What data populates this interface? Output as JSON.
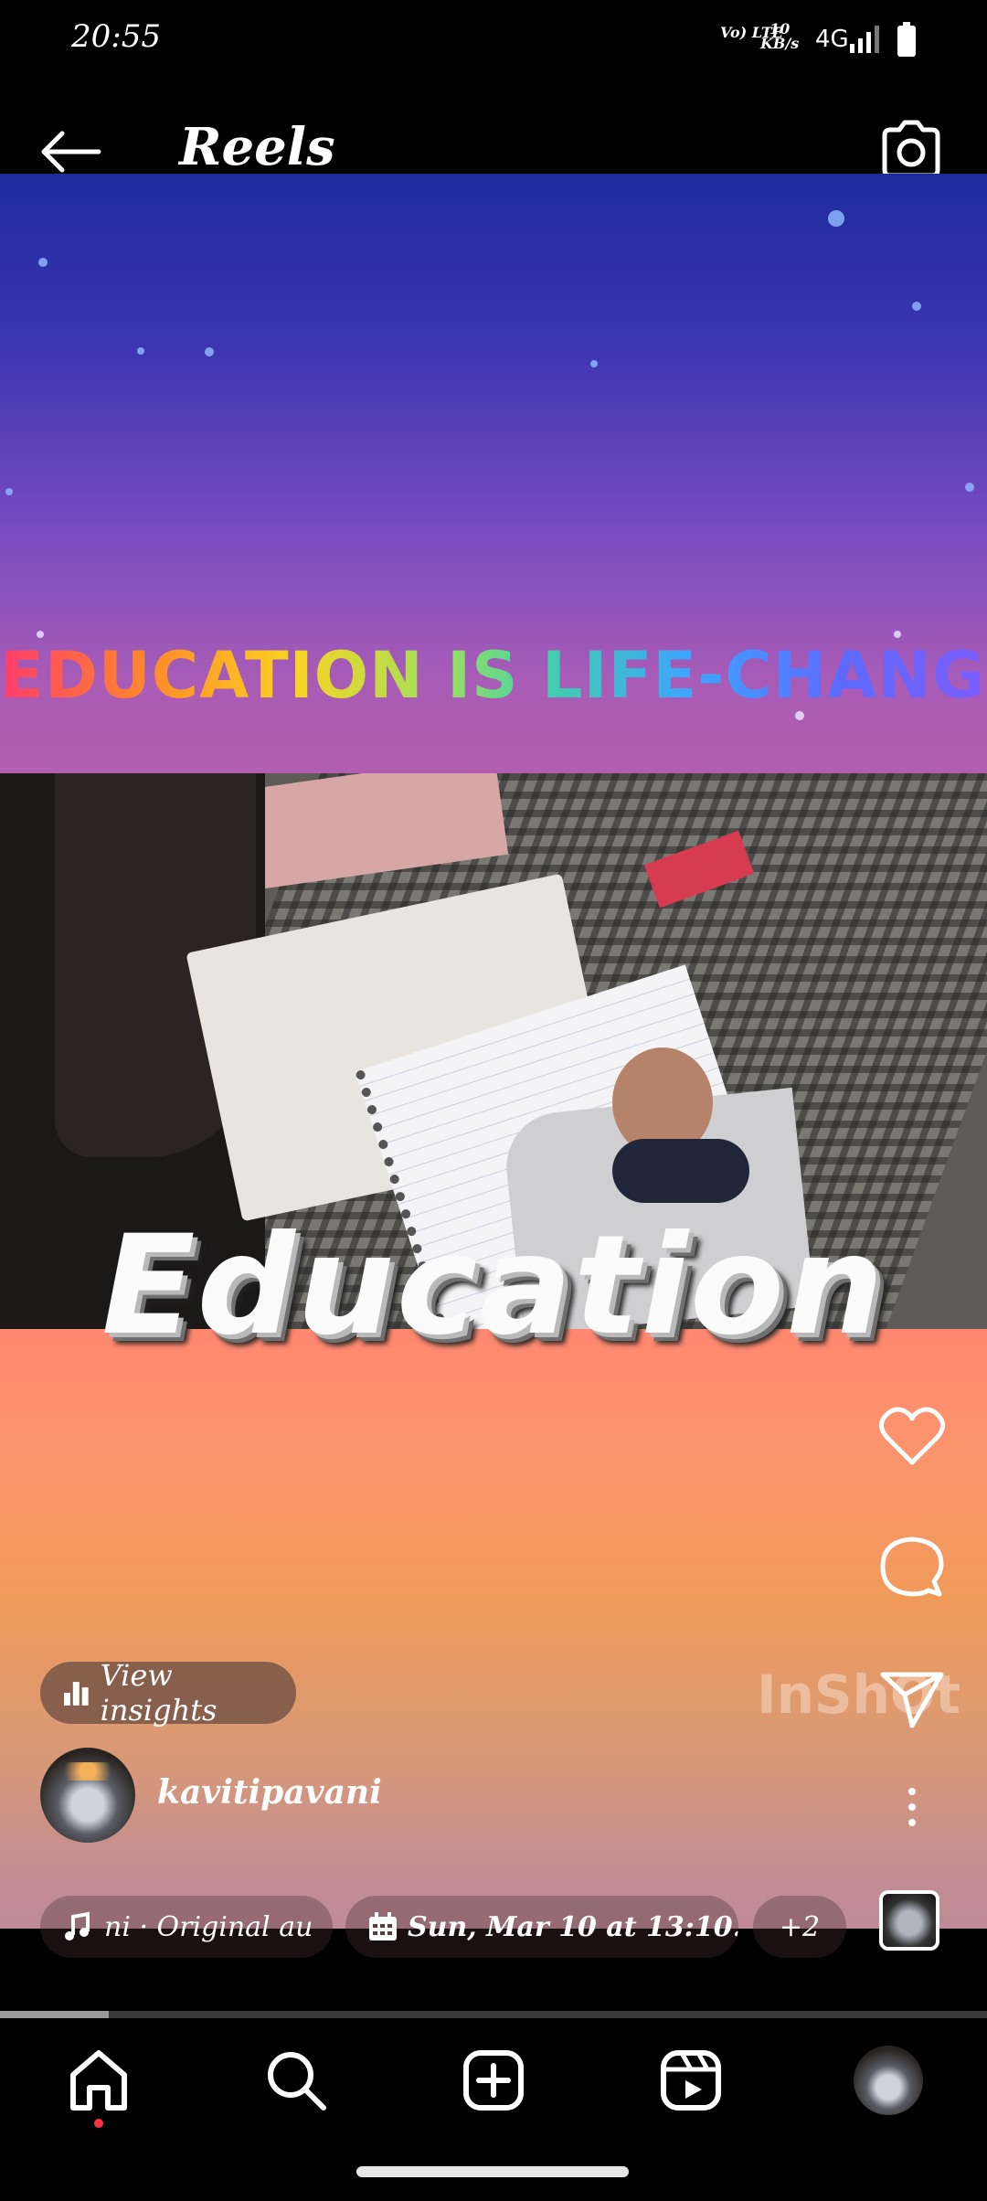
{
  "status_bar": {
    "time": "20:55",
    "volte_label": "Vo) LTE",
    "speed_value": "10",
    "speed_unit": "KB/s",
    "network": "4G"
  },
  "header": {
    "title": "Reels",
    "back_icon": "arrow-left-icon",
    "camera_icon": "camera-icon"
  },
  "reel": {
    "headline": "EDUCATION IS LIFE-CHANGING",
    "big_title": "Education",
    "watermark": "InShOt",
    "progress": 0.11
  },
  "actions": {
    "like_icon": "heart-icon",
    "comment_icon": "comment-bubble-icon",
    "share_icon": "paper-plane-icon",
    "more_icon": "more-vertical-icon"
  },
  "insights": {
    "label": "View insights"
  },
  "user": {
    "username": "kavitipavani"
  },
  "chips": {
    "audio": "ni · Original au",
    "date": "Sun, Mar 10 at 13:10...",
    "more": "+2"
  },
  "nav": {
    "items": [
      "home-icon",
      "search-icon",
      "create-icon",
      "reels-icon",
      "profile-avatar"
    ],
    "active": "home-icon"
  },
  "colors": {
    "notification_dot": "#ff3040"
  }
}
